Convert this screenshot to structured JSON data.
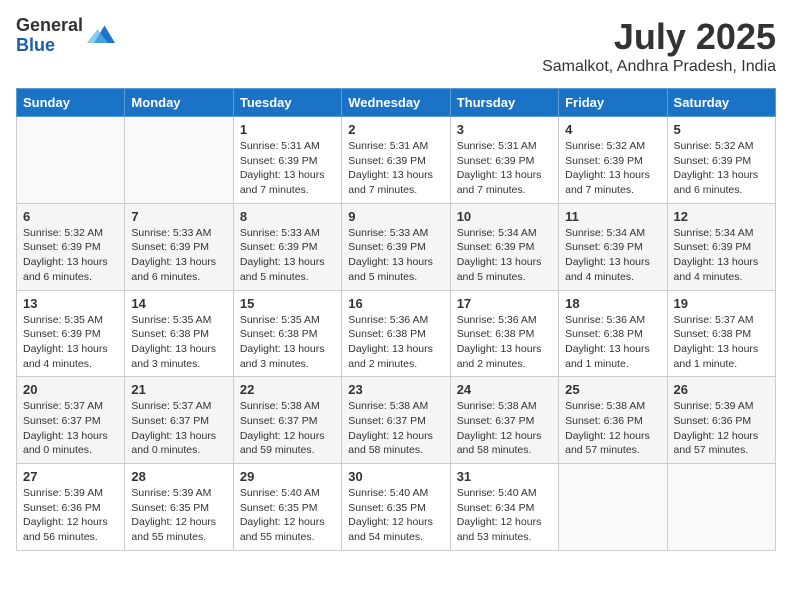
{
  "logo": {
    "general": "General",
    "blue": "Blue"
  },
  "title": "July 2025",
  "location": "Samalkot, Andhra Pradesh, India",
  "days_of_week": [
    "Sunday",
    "Monday",
    "Tuesday",
    "Wednesday",
    "Thursday",
    "Friday",
    "Saturday"
  ],
  "weeks": [
    [
      {
        "day": "",
        "info": ""
      },
      {
        "day": "",
        "info": ""
      },
      {
        "day": "1",
        "info": "Sunrise: 5:31 AM\nSunset: 6:39 PM\nDaylight: 13 hours and 7 minutes."
      },
      {
        "day": "2",
        "info": "Sunrise: 5:31 AM\nSunset: 6:39 PM\nDaylight: 13 hours and 7 minutes."
      },
      {
        "day": "3",
        "info": "Sunrise: 5:31 AM\nSunset: 6:39 PM\nDaylight: 13 hours and 7 minutes."
      },
      {
        "day": "4",
        "info": "Sunrise: 5:32 AM\nSunset: 6:39 PM\nDaylight: 13 hours and 7 minutes."
      },
      {
        "day": "5",
        "info": "Sunrise: 5:32 AM\nSunset: 6:39 PM\nDaylight: 13 hours and 6 minutes."
      }
    ],
    [
      {
        "day": "6",
        "info": "Sunrise: 5:32 AM\nSunset: 6:39 PM\nDaylight: 13 hours and 6 minutes."
      },
      {
        "day": "7",
        "info": "Sunrise: 5:33 AM\nSunset: 6:39 PM\nDaylight: 13 hours and 6 minutes."
      },
      {
        "day": "8",
        "info": "Sunrise: 5:33 AM\nSunset: 6:39 PM\nDaylight: 13 hours and 5 minutes."
      },
      {
        "day": "9",
        "info": "Sunrise: 5:33 AM\nSunset: 6:39 PM\nDaylight: 13 hours and 5 minutes."
      },
      {
        "day": "10",
        "info": "Sunrise: 5:34 AM\nSunset: 6:39 PM\nDaylight: 13 hours and 5 minutes."
      },
      {
        "day": "11",
        "info": "Sunrise: 5:34 AM\nSunset: 6:39 PM\nDaylight: 13 hours and 4 minutes."
      },
      {
        "day": "12",
        "info": "Sunrise: 5:34 AM\nSunset: 6:39 PM\nDaylight: 13 hours and 4 minutes."
      }
    ],
    [
      {
        "day": "13",
        "info": "Sunrise: 5:35 AM\nSunset: 6:39 PM\nDaylight: 13 hours and 4 minutes."
      },
      {
        "day": "14",
        "info": "Sunrise: 5:35 AM\nSunset: 6:38 PM\nDaylight: 13 hours and 3 minutes."
      },
      {
        "day": "15",
        "info": "Sunrise: 5:35 AM\nSunset: 6:38 PM\nDaylight: 13 hours and 3 minutes."
      },
      {
        "day": "16",
        "info": "Sunrise: 5:36 AM\nSunset: 6:38 PM\nDaylight: 13 hours and 2 minutes."
      },
      {
        "day": "17",
        "info": "Sunrise: 5:36 AM\nSunset: 6:38 PM\nDaylight: 13 hours and 2 minutes."
      },
      {
        "day": "18",
        "info": "Sunrise: 5:36 AM\nSunset: 6:38 PM\nDaylight: 13 hours and 1 minute."
      },
      {
        "day": "19",
        "info": "Sunrise: 5:37 AM\nSunset: 6:38 PM\nDaylight: 13 hours and 1 minute."
      }
    ],
    [
      {
        "day": "20",
        "info": "Sunrise: 5:37 AM\nSunset: 6:37 PM\nDaylight: 13 hours and 0 minutes."
      },
      {
        "day": "21",
        "info": "Sunrise: 5:37 AM\nSunset: 6:37 PM\nDaylight: 13 hours and 0 minutes."
      },
      {
        "day": "22",
        "info": "Sunrise: 5:38 AM\nSunset: 6:37 PM\nDaylight: 12 hours and 59 minutes."
      },
      {
        "day": "23",
        "info": "Sunrise: 5:38 AM\nSunset: 6:37 PM\nDaylight: 12 hours and 58 minutes."
      },
      {
        "day": "24",
        "info": "Sunrise: 5:38 AM\nSunset: 6:37 PM\nDaylight: 12 hours and 58 minutes."
      },
      {
        "day": "25",
        "info": "Sunrise: 5:38 AM\nSunset: 6:36 PM\nDaylight: 12 hours and 57 minutes."
      },
      {
        "day": "26",
        "info": "Sunrise: 5:39 AM\nSunset: 6:36 PM\nDaylight: 12 hours and 57 minutes."
      }
    ],
    [
      {
        "day": "27",
        "info": "Sunrise: 5:39 AM\nSunset: 6:36 PM\nDaylight: 12 hours and 56 minutes."
      },
      {
        "day": "28",
        "info": "Sunrise: 5:39 AM\nSunset: 6:35 PM\nDaylight: 12 hours and 55 minutes."
      },
      {
        "day": "29",
        "info": "Sunrise: 5:40 AM\nSunset: 6:35 PM\nDaylight: 12 hours and 55 minutes."
      },
      {
        "day": "30",
        "info": "Sunrise: 5:40 AM\nSunset: 6:35 PM\nDaylight: 12 hours and 54 minutes."
      },
      {
        "day": "31",
        "info": "Sunrise: 5:40 AM\nSunset: 6:34 PM\nDaylight: 12 hours and 53 minutes."
      },
      {
        "day": "",
        "info": ""
      },
      {
        "day": "",
        "info": ""
      }
    ]
  ]
}
